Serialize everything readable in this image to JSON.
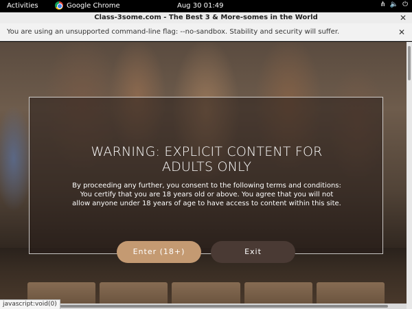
{
  "system_bar": {
    "activities": "Activities",
    "app_name": "Google Chrome",
    "clock": "Aug 30  01:49"
  },
  "window": {
    "title": "Class-3some.com - The Best 3 & More-somes in the World"
  },
  "infobar": {
    "message": "You are using an unsupported command-line flag: --no-sandbox. Stability and security will suffer."
  },
  "modal": {
    "heading": "WARNING: EXPLICIT CONTENT FOR ADULTS ONLY",
    "terms": "By proceeding any further, you consent to the following terms and conditions: You certify that you are 18 years old or above. You agree that you will not allow anyone under 18 years of age to have access to content within this site.",
    "enter_label": "Enter (18+)",
    "exit_label": "Exit"
  },
  "status_bar": {
    "url": "javascript:void(0)"
  },
  "colors": {
    "enter_button": "#c49a72",
    "exit_button": "#4a3a34"
  }
}
